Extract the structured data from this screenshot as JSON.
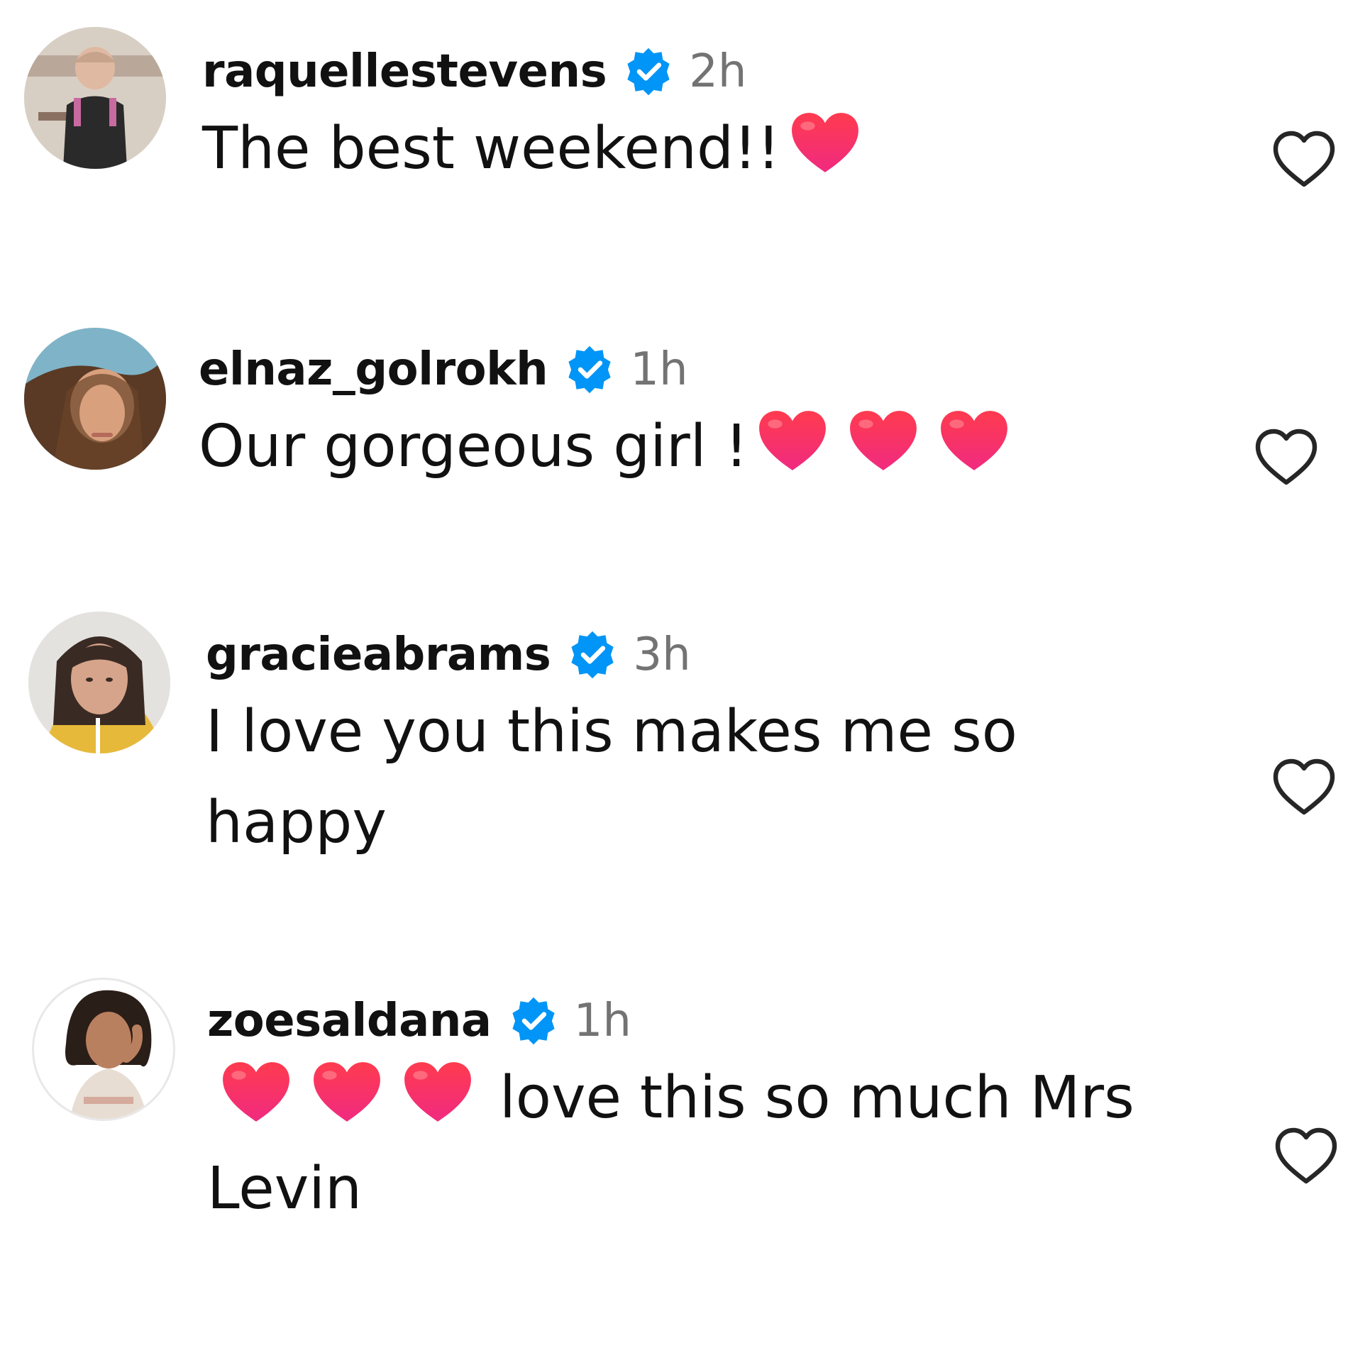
{
  "colors": {
    "verified_badge": "#0095f6",
    "timestamp": "#737373",
    "heart_emoji": "#ef2d56",
    "like_outline": "#262626"
  },
  "comments": [
    {
      "username": "raquellestevens",
      "verified": true,
      "time": "2h",
      "text_before": "The best weekend!!",
      "emoji_after": [
        "heart"
      ],
      "text_after": "",
      "like_icon": "heart-outline-icon"
    },
    {
      "username": "elnaz_golrokh",
      "verified": true,
      "time": "1h",
      "text_before": "Our gorgeous girl !",
      "emoji_after": [
        "heart",
        "heart",
        "heart"
      ],
      "text_after": "",
      "like_icon": "heart-outline-icon"
    },
    {
      "username": "gracieabrams",
      "verified": true,
      "time": "3h",
      "text_before": "I love you this makes me so happy",
      "emoji_after": [],
      "text_after": "",
      "like_icon": "heart-outline-icon"
    },
    {
      "username": "zoesaldana",
      "verified": true,
      "time": "1h",
      "text_before": "",
      "emoji_after": [
        "heart",
        "heart",
        "heart"
      ],
      "text_after": "love this so much Mrs Levin",
      "like_icon": "heart-outline-icon"
    }
  ]
}
